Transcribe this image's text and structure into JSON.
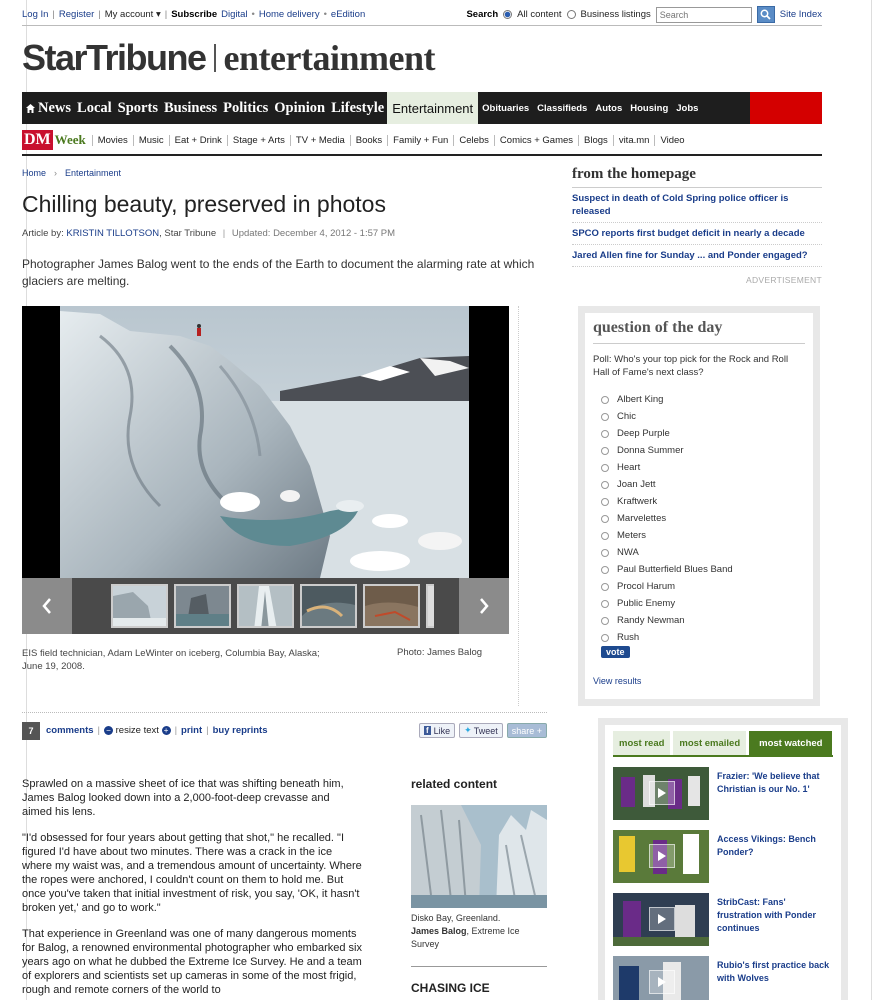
{
  "utility": {
    "left_links": [
      "Log In",
      "Register",
      "My account ▾",
      "Subscribe",
      "Digital",
      "Home delivery",
      "eEdition"
    ],
    "search_label": "Search",
    "scope_all": "All content",
    "scope_business": "Business listings",
    "search_placeholder": "Search",
    "site_index": "Site Index"
  },
  "masthead": {
    "brand": "StarTribune",
    "section": "entertainment"
  },
  "main_nav": {
    "big": [
      "News",
      "Local",
      "Sports",
      "Business",
      "Politics",
      "Opinion",
      "Lifestyle"
    ],
    "active": "Entertainment",
    "small": [
      "Obituaries",
      "Classifieds",
      "Autos",
      "Housing",
      "Jobs"
    ]
  },
  "sub_nav": {
    "dm": "DM",
    "week": "Week",
    "items": [
      "Movies",
      "Music",
      "Eat + Drink",
      "Stage + Arts",
      "TV + Media",
      "Books",
      "Family + Fun",
      "Celebs",
      "Comics + Games",
      "Blogs",
      "vita.mn",
      "Video"
    ]
  },
  "breadcrumb": [
    "Home",
    "Entertainment"
  ],
  "article": {
    "title": "Chilling beauty, preserved in photos",
    "by_prefix": "Article by:",
    "author": "KRISTIN TILLOTSON",
    "source": ", Star Tribune",
    "updated": "Updated: December 4, 2012 - 1:57 PM",
    "dek": "Photographer James Balog went to the ends of the Earth to document the alarming rate at which glaciers are melting.",
    "caption": "EIS field technician, Adam LeWinter on iceberg, Columbia Bay, Alaska; June 19, 2008.",
    "photo_credit": "Photo: James Balog",
    "paragraphs": [
      "Sprawled on a massive sheet of ice that was shifting beneath him, James Balog looked down into a 2,000-foot-deep crevasse and aimed his lens.",
      "\"I'd obsessed for four years about getting that shot,\" he recalled. \"I figured I'd have about two minutes. There was a crack in the ice where my waist was, and a tremendous amount of uncertainty. Where the ropes were anchored, I couldn't count on them to hold me. But once you've taken that initial investment of risk, you say, 'OK, it hasn't broken yet,' and go to work.\"",
      "That experience in Greenland was one of many dangerous moments for Balog, a renowned environmental photographer who embarked six years ago on what he dubbed the Extreme Ice Survey. He and a team of explorers and scientists set up cameras in some of the most frigid, rough and remote corners of the world to"
    ]
  },
  "tools": {
    "comment_count": "7",
    "comments": "comments",
    "resize": "resize text",
    "print": "print",
    "reprints": "buy reprints",
    "like": "Like",
    "tweet": "Tweet",
    "share": "share +"
  },
  "related": {
    "heading": "related content",
    "caption_place": "Disko Bay, Greenland.",
    "caption_credit": "James Balog",
    "caption_org": ", Extreme Ice Survey",
    "next_heading": "CHASING ICE"
  },
  "homepage": {
    "heading": "from the homepage",
    "links": [
      "Suspect in death of Cold Spring police officer is released",
      "SPCO reports first budget deficit in nearly a decade",
      "Jared Allen fine for Sunday ... and Ponder engaged?"
    ],
    "ad_label": "ADVERTISEMENT"
  },
  "qotd": {
    "heading": "question of the day",
    "question": "Poll: Who's your top pick for the Rock and Roll Hall of Fame's next class?",
    "options": [
      "Albert King",
      "Chic",
      "Deep Purple",
      "Donna Summer",
      "Heart",
      "Joan Jett",
      "Kraftwerk",
      "Marvelettes",
      "Meters",
      "NWA",
      "Paul Butterfield Blues Band",
      "Procol Harum",
      "Public Enemy",
      "Randy Newman",
      "Rush"
    ],
    "vote": "vote",
    "view_results": "View results"
  },
  "most": {
    "tabs": [
      "most read",
      "most emailed",
      "most watched"
    ],
    "videos": [
      "Frazier: 'We believe that Christian is our No. 1'",
      "Access Vikings: Bench Ponder?",
      "StribCast: Fans' frustration with Ponder continues",
      "Rubio's first practice back with Wolves"
    ]
  },
  "colors": {
    "nav_bg": "#1e1e1e",
    "accent_red": "#d40000",
    "link_blue": "#1a3d8a",
    "dm_green": "#4b7a1f"
  }
}
